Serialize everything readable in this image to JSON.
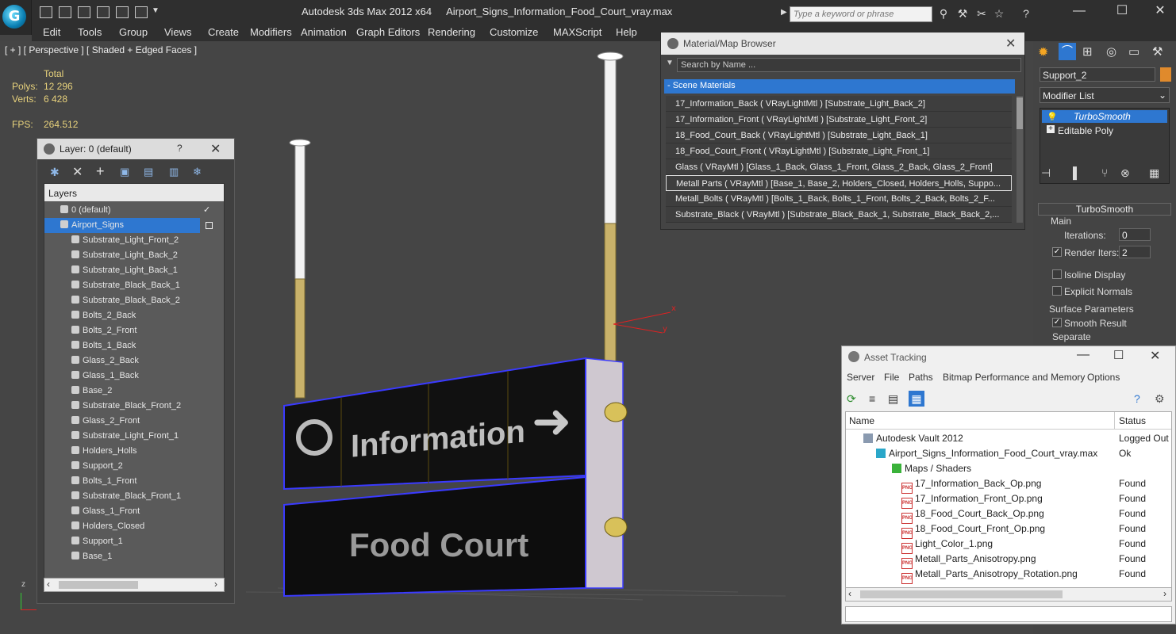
{
  "app": {
    "title": "Autodesk 3ds Max  2012 x64",
    "file": "Airport_Signs_Information_Food_Court_vray.max",
    "search_placeholder": "Type a keyword or phrase"
  },
  "menu": [
    "Edit",
    "Tools",
    "Group",
    "Views",
    "Create",
    "Modifiers",
    "Animation",
    "Graph Editors",
    "Rendering",
    "Customize",
    "MAXScript",
    "Help"
  ],
  "viewport": {
    "label": "[ + ] [ Perspective ] [ Shaded + Edged Faces ]",
    "stats_header": "Total",
    "polys_label": "Polys:",
    "polys_value": "12 296",
    "verts_label": "Verts:",
    "verts_value": "6 428",
    "fps_label": "FPS:",
    "fps_value": "264.512",
    "sign_top_text": "Information",
    "sign_bottom_text": "Food Court",
    "axis_x": "x",
    "axis_y": "y",
    "axis_z": "z"
  },
  "layer_window": {
    "title": "Layer: 0 (default)",
    "help": "?",
    "header": "Layers",
    "default_layer": "0 (default)",
    "active_layer": "Airport_Signs",
    "objects": [
      "Substrate_Light_Front_2",
      "Substrate_Light_Back_2",
      "Substrate_Light_Back_1",
      "Substrate_Black_Back_1",
      "Substrate_Black_Back_2",
      "Bolts_2_Back",
      "Bolts_2_Front",
      "Bolts_1_Back",
      "Glass_2_Back",
      "Glass_1_Back",
      "Base_2",
      "Substrate_Black_Front_2",
      "Glass_2_Front",
      "Substrate_Light_Front_1",
      "Holders_Holls",
      "Support_2",
      "Bolts_1_Front",
      "Substrate_Black_Front_1",
      "Glass_1_Front",
      "Holders_Closed",
      "Support_1",
      "Base_1"
    ]
  },
  "material_browser": {
    "title": "Material/Map Browser",
    "search_placeholder": "Search by Name ...",
    "group": "- Scene Materials",
    "materials": [
      "17_Information_Back  ( VRayLightMtl ) [Substrate_Light_Back_2]",
      "17_Information_Front  ( VRayLightMtl ) [Substrate_Light_Front_2]",
      "18_Food_Court_Back  ( VRayLightMtl ) [Substrate_Light_Back_1]",
      "18_Food_Court_Front  ( VRayLightMtl ) [Substrate_Light_Front_1]",
      "Glass  ( VRayMtl ) [Glass_1_Back, Glass_1_Front, Glass_2_Back, Glass_2_Front]",
      "Metall Parts  ( VRayMtl ) [Base_1, Base_2, Holders_Closed, Holders_Holls, Suppo...",
      "Metall_Bolts  ( VRayMtl ) [Bolts_1_Back, Bolts_1_Front, Bolts_2_Back, Bolts_2_F...",
      "Substrate_Black  ( VRayMtl ) [Substrate_Black_Back_1, Substrate_Black_Back_2,..."
    ]
  },
  "command_panel": {
    "object_name": "Support_2",
    "modifier_list": "Modifier List",
    "stack": [
      "TurboSmooth",
      "Editable Poly"
    ],
    "rollout_title": "TurboSmooth",
    "main_label": "Main",
    "iterations_label": "Iterations:",
    "iterations_value": "0",
    "render_iters_label": "Render Iters:",
    "render_iters_value": "2",
    "isoline_label": "Isoline Display",
    "explicit_normals_label": "Explicit Normals",
    "surface_params_label": "Surface Parameters",
    "smooth_result_label": "Smooth Result",
    "separate_label": "Separate"
  },
  "asset_tracking": {
    "title": "Asset Tracking",
    "menu": [
      "Server",
      "File",
      "Paths",
      "Bitmap Performance and Memory",
      "Options"
    ],
    "col_name": "Name",
    "col_status": "Status",
    "rows": [
      {
        "name": "Autodesk Vault 2012",
        "status": "Logged Out"
      },
      {
        "name": "Airport_Signs_Information_Food_Court_vray.max",
        "status": "Ok"
      },
      {
        "name": "Maps / Shaders",
        "status": ""
      },
      {
        "name": "17_Information_Back_Op.png",
        "status": "Found"
      },
      {
        "name": "17_Information_Front_Op.png",
        "status": "Found"
      },
      {
        "name": "18_Food_Court_Back_Op.png",
        "status": "Found"
      },
      {
        "name": "18_Food_Court_Front_Op.png",
        "status": "Found"
      },
      {
        "name": "Light_Color_1.png",
        "status": "Found"
      },
      {
        "name": "Metall_Parts_Anisotropy.png",
        "status": "Found"
      },
      {
        "name": "Metall_Parts_Anisotropy_Rotation.png",
        "status": "Found"
      }
    ]
  },
  "icons": {
    "png_badge": "PNG",
    "checkmark": "✓"
  },
  "colors": {
    "selection_blue": "#2e77d0",
    "stats_yellow": "#e8d27c",
    "wire_blue": "#3a3aff"
  }
}
